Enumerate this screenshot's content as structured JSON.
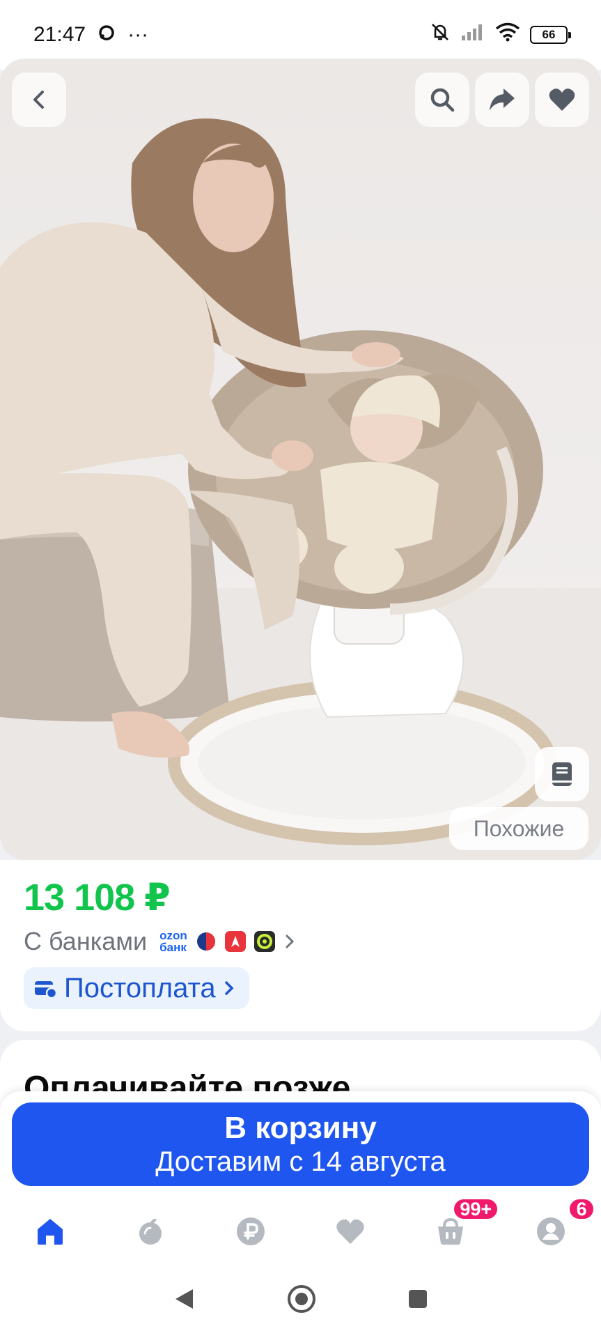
{
  "status_bar": {
    "time": "21:47",
    "dots": "···",
    "battery": "66"
  },
  "hero": {
    "buttons": [
      "back",
      "search",
      "share",
      "favorite"
    ],
    "similar_label": "Похожие"
  },
  "product": {
    "price": "13 108 ₽",
    "banks_label": "С банками",
    "ozon_bank_logo": [
      "ozon",
      "банк"
    ],
    "postpay_label": "Постоплата",
    "accent_color": "#10c44c"
  },
  "next_section": {
    "title": "Оплачивайте позже"
  },
  "cart": {
    "title": "В корзину",
    "subtitle": "Доставим с 14 августа",
    "color": "#1f56f0"
  },
  "bottom_nav": {
    "items": [
      "home",
      "fresh",
      "finance",
      "favorites",
      "cart",
      "profile"
    ],
    "cart_badge": "99+",
    "profile_badge": "6",
    "active_color": "#1f56f0",
    "inactive_color": "#b5b9c0"
  }
}
